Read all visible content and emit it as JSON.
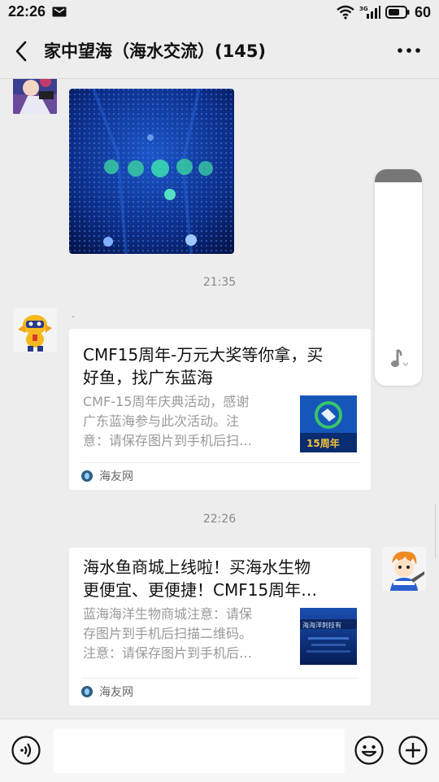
{
  "status_bar": {
    "time": "22:26",
    "battery": "60",
    "icons": [
      "message-notification-icon",
      "wifi-icon",
      "4g-signal-icon",
      "battery-icon"
    ]
  },
  "navbar": {
    "title": "家中望海（海水交流）(145)",
    "back_icon": "back-chevron-icon",
    "more_icon": "more-dots-icon"
  },
  "messages": [
    {
      "type": "image",
      "sender_side": "left"
    },
    {
      "type": "timestamp",
      "text": "21:35"
    },
    {
      "type": "link_card",
      "sender_side": "left",
      "sender_name": "·",
      "title": "CMF15周年-万元大奖等你拿，买好鱼，找广东蓝海",
      "title_lines": [
        "CMF15周年-万元大奖等你拿，买",
        "好鱼，找广东蓝海"
      ],
      "description_lines": [
        "CMF-15周年庆典活动，感谢",
        "广东蓝海参与此次活动。注",
        "意：请保存图片到手机后扫…"
      ],
      "thumb_text": "15周年",
      "source": "海友网"
    },
    {
      "type": "timestamp",
      "text": "22:26"
    },
    {
      "type": "link_card",
      "sender_side": "right",
      "title_lines": [
        "海水鱼商城上线啦！买海水生物",
        "更便宜、更便捷！CMF15周年…"
      ],
      "description_lines": [
        "蓝海海洋生物商城注意：请保",
        "存图片到手机后扫描二维码。",
        "注意：请保存图片到手机后…"
      ],
      "thumb_text": "海海洋刺技有",
      "source": "海友网"
    }
  ],
  "input_bar": {
    "voice_icon": "voice-input-icon",
    "emoji_icon": "emoji-icon",
    "plus_icon": "more-plus-icon",
    "input_value": ""
  },
  "floating_widget": {
    "icon": "music-note-icon"
  },
  "colors": {
    "background": "#ededed",
    "card": "#ffffff",
    "muted_text": "#999999",
    "timestamp": "#888888"
  }
}
